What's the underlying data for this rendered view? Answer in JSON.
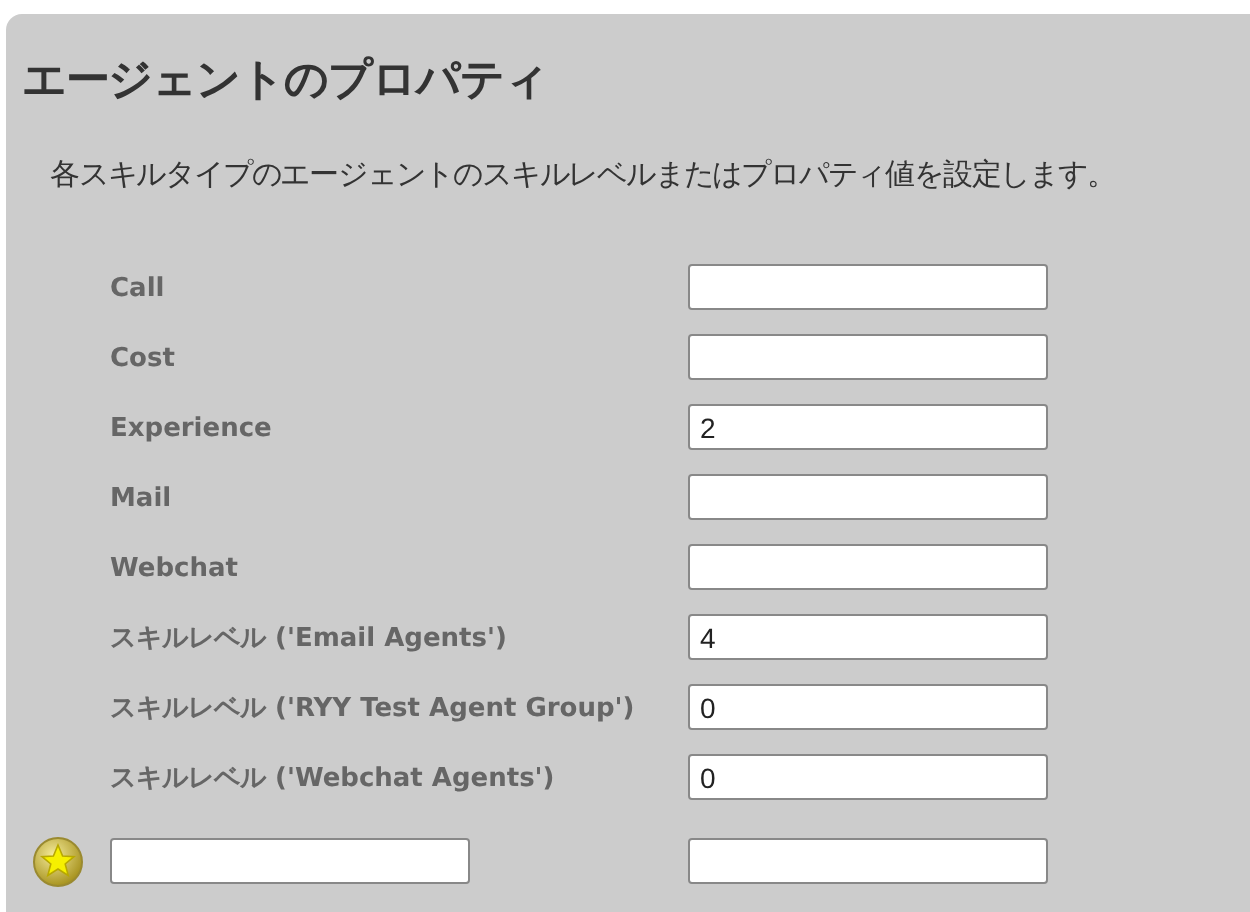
{
  "title": "エージェントのプロパティ",
  "description": "各スキルタイプのエージェントのスキルレベルまたはプロパティ値を設定します。",
  "properties": [
    {
      "label": "Call"
    },
    {
      "label": "Cost"
    },
    {
      "label": "Experience",
      "value": "2"
    },
    {
      "label": "Mail"
    },
    {
      "label": "Webchat"
    },
    {
      "label": "スキルレベル ('Email Agents')",
      "value": "4"
    },
    {
      "label": "スキルレベル ('RYY Test Agent Group')",
      "value": "0"
    },
    {
      "label": "スキルレベル ('Webchat Agents')",
      "value": "0"
    }
  ]
}
